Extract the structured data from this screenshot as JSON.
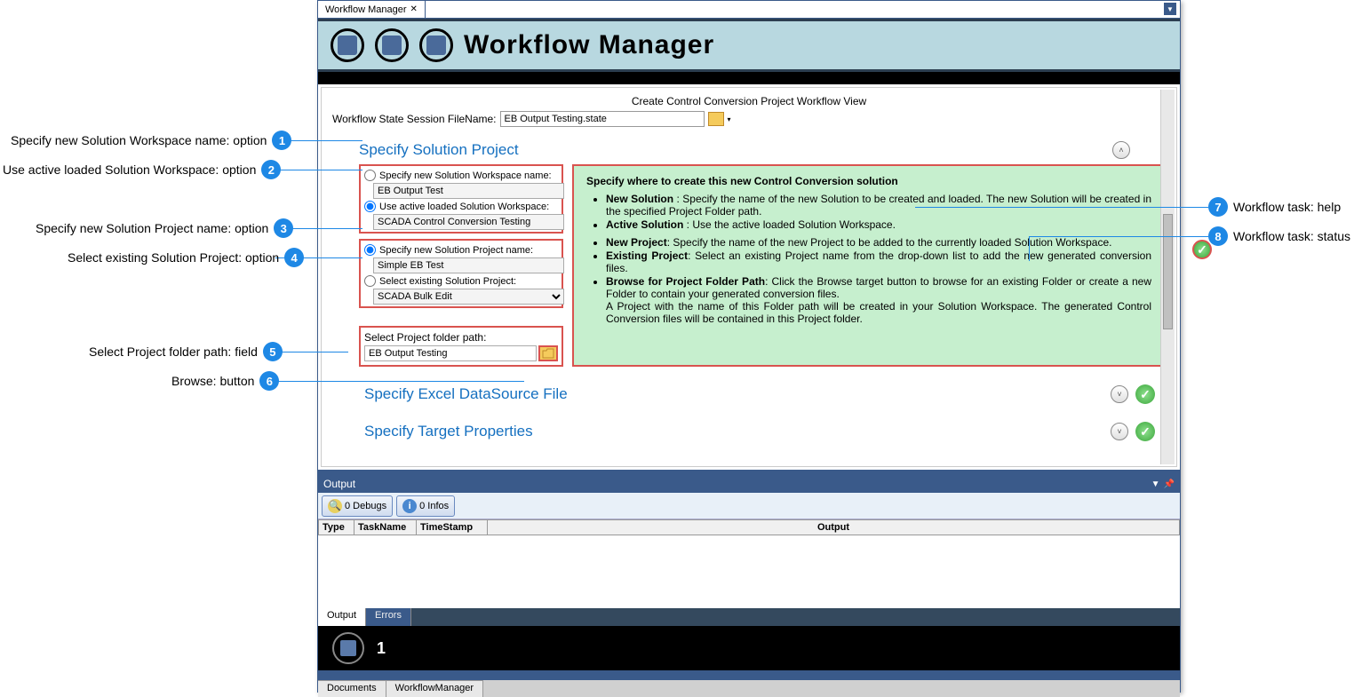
{
  "callouts": {
    "c1": "Specify new Solution Workspace name: option",
    "c2": "Use active loaded Solution Workspace: option",
    "c3": "Specify new Solution Project name: option",
    "c4": "Select existing Solution Project: option",
    "c5": "Select Project folder path: field",
    "c6": "Browse: button",
    "c7": "Workflow task: help",
    "c8": "Workflow task: status"
  },
  "tab": {
    "title": "Workflow Manager"
  },
  "header": {
    "title": "Workflow Manager"
  },
  "view": {
    "title": "Create Control Conversion Project Workflow View",
    "session_label": "Workflow State Session FileName:",
    "session_value": "EB Output Testing.state"
  },
  "section1": {
    "title": "Specify Solution Project",
    "opt1_label": "Specify new Solution Workspace name:",
    "opt1_value": "EB Output Test",
    "opt2_label": "Use active loaded Solution Workspace:",
    "opt2_value": "SCADA Control Conversion Testing",
    "opt3_label": "Specify new Solution Project name:",
    "opt3_value": "Simple EB Test",
    "opt4_label": "Select existing Solution Project:",
    "opt4_value": "SCADA Bulk Edit",
    "folder_label": "Select Project folder path:",
    "folder_value": "EB Output Testing"
  },
  "help": {
    "title": "Specify where to create this new Control Conversion solution",
    "b1_k": "New Solution",
    "b1_v": " : Specify the name of the new Solution to be created and loaded. The new Solution will be created in the specified Project Folder path.",
    "b2_k": "Active Solution",
    "b2_v": " : Use the active loaded Solution Workspace.",
    "b3_k": "New Project",
    "b3_v": ": Specify the name of the new Project to be added to the currently loaded Solution Workspace.",
    "b4_k": "Existing Project",
    "b4_v": ": Select an existing Project name from the drop-down list to add the new generated conversion files.",
    "b5_k": "Browse for Project Folder Path",
    "b5_v": ": Click the Browse target button to browse for an existing Folder or create a new Folder to contain your generated conversion files.",
    "b5_extra": "A Project with the name of this Folder path will be created in your Solution Workspace. The generated Control Conversion files will be contained in this Project folder."
  },
  "section2": {
    "title": "Specify Excel DataSource File"
  },
  "section3": {
    "title": "Specify Target Properties"
  },
  "output": {
    "title": "Output",
    "debugs": "0 Debugs",
    "infos": "0 Infos",
    "col_type": "Type",
    "col_task": "TaskName",
    "col_ts": "TimeStamp",
    "col_out": "Output",
    "tab_output": "Output",
    "tab_errors": "Errors"
  },
  "bottom": {
    "num": "1"
  },
  "doctabs": {
    "documents": "Documents",
    "wfm": "WorkflowManager"
  }
}
